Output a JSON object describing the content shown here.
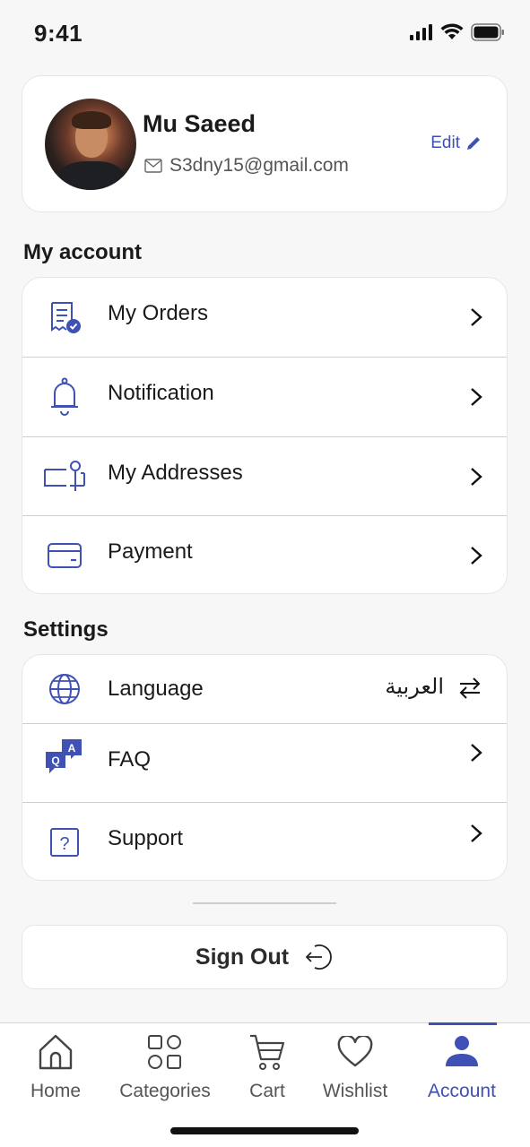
{
  "status_bar": {
    "time": "9:41"
  },
  "profile": {
    "name": "Mu Saeed",
    "email": "S3dny15@gmail.com",
    "edit_label": "Edit"
  },
  "my_account": {
    "title": "My account",
    "items": [
      {
        "label": "My Orders",
        "icon": "orders-receipt-icon"
      },
      {
        "label": "Notification",
        "icon": "bell-icon"
      },
      {
        "label": "My Addresses",
        "icon": "address-pin-icon"
      },
      {
        "label": "Payment",
        "icon": "card-icon"
      }
    ]
  },
  "settings": {
    "title": "Settings",
    "items": [
      {
        "label": "Language",
        "value": "العربية",
        "icon": "globe-icon"
      },
      {
        "label": "FAQ",
        "icon": "faq-chat-icon"
      },
      {
        "label": "Support",
        "icon": "question-icon"
      }
    ]
  },
  "sign_out": {
    "label": "Sign Out"
  },
  "tabbar": {
    "tabs": [
      {
        "label": "Home",
        "icon": "home-icon"
      },
      {
        "label": "Categories",
        "icon": "categories-icon"
      },
      {
        "label": "Cart",
        "icon": "cart-icon"
      },
      {
        "label": "Wishlist",
        "icon": "heart-icon"
      },
      {
        "label": "Account",
        "icon": "account-icon",
        "active": true
      }
    ]
  },
  "colors": {
    "accent": "#3f51b5",
    "background": "#f7f7f7"
  }
}
